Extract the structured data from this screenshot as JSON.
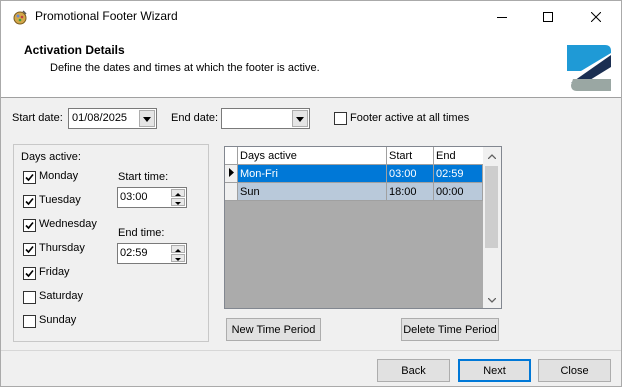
{
  "window": {
    "title": "Promotional Footer Wizard",
    "controls": [
      "minimize-icon",
      "maximize-icon",
      "close-icon"
    ]
  },
  "header": {
    "title": "Activation Details",
    "subtitle": "Define the dates and times at which the footer is active."
  },
  "dates": {
    "start_label": "Start date:",
    "start_value": "01/08/2025",
    "end_label": "End date:",
    "end_value": "",
    "always_active_label": "Footer active at all times",
    "always_active_checked": false
  },
  "days_panel": {
    "title": "Days active:",
    "days": [
      {
        "label": "Monday",
        "checked": true
      },
      {
        "label": "Tuesday",
        "checked": true
      },
      {
        "label": "Wednesday",
        "checked": true
      },
      {
        "label": "Thursday",
        "checked": true
      },
      {
        "label": "Friday",
        "checked": true
      },
      {
        "label": "Saturday",
        "checked": false
      },
      {
        "label": "Sunday",
        "checked": false
      }
    ],
    "start_time_label": "Start time:",
    "start_time_value": "03:00",
    "end_time_label": "End time:",
    "end_time_value": "02:59"
  },
  "grid": {
    "columns": [
      "Days active",
      "Start",
      "End"
    ],
    "rows": [
      {
        "days": "Mon-Fri",
        "start": "03:00",
        "end": "02:59",
        "selected": true
      },
      {
        "days": "Sun",
        "start": "18:00",
        "end": "00:00",
        "selected": false
      }
    ]
  },
  "actions": {
    "new_period": "New Time Period",
    "delete_period": "Delete Time Period"
  },
  "footer": {
    "back": "Back",
    "next": "Next",
    "close": "Close"
  },
  "colors": {
    "selection": "#0078d7",
    "alt_row": "#b9c9da",
    "logo_blue": "#1f9ad6",
    "logo_navy": "#1b2f52",
    "logo_gray": "#9aa7a3"
  }
}
